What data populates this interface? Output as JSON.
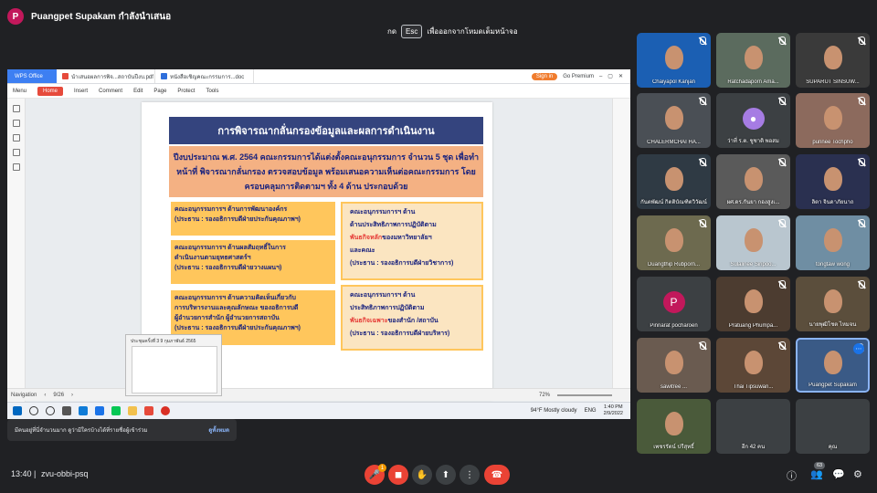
{
  "presenter": {
    "avatar_letter": "P",
    "text": "Puangpet Supakam กำลังนำเสนอ"
  },
  "esc_bar": {
    "prefix": "กด",
    "key": "Esc",
    "suffix": "เพื่อออกจากโหมดเต็มหน้าจอ"
  },
  "wps": {
    "app_tab": "WPS Office",
    "tabs": [
      "นำเสนอผลการพิจ...สถาบันปีงบ.pdf",
      "หนังสือเชิญคณะกรรมการ...doc"
    ],
    "sign_in": "Sign in",
    "go_premium": "Go Premium",
    "menu": [
      "Menu",
      "Home",
      "Insert",
      "Comment",
      "Edit",
      "Page",
      "Protect",
      "Tools"
    ],
    "navigation": "Navigation",
    "page_counter": "9/26",
    "zoom": "72%"
  },
  "slide": {
    "title": "การพิจารณากลั่นกรองข้อมูลและผลการดำเนินงาน",
    "intro": "ปีงบประมาณ พ.ศ. 2564 คณะกรรมการได้แต่งตั้งคณะอนุกรรมการ จำนวน 5 ชุด เพื่อทำหน้าที่ พิจารณากลั่นกรอง ตรวจสอบข้อมูล พร้อมเสนอความเห็นต่อคณะกรรมการ โดยครอบคลุมการติดตามฯ ทั้ง 4 ด้าน ประกอบด้วย",
    "box1": {
      "line1": "คณะอนุกรรมการฯ ด้านการพัฒนาองค์กร",
      "line2": "(ประธาน : รองอธิการบดีฝ่ายประกันคุณภาพฯ)"
    },
    "box2": {
      "line1": "คณะอนุกรรมการฯ ด้านผลสัมฤทธิ์ในการ",
      "line2": "ดำเนินงานตามยุทธศาสตร์ฯ",
      "line3": "(ประธาน : รองอธิการบดีฝ่ายวางแผนฯ)"
    },
    "box3": {
      "line1": "คณะอนุกรรมการฯ ด้านความคิดเห็นเกี่ยวกับ",
      "line2": "การบริหารงานและคุณลักษณะ ของอธิการบดี",
      "line3": "ผู้อำนวยการสำนัก ผู้อำนวยการสถาบัน",
      "line4": "(ประธาน : รองอธิการบดีฝ่ายประกันคุณภาพฯ)"
    },
    "box4": {
      "line1": "คณะอนุกรรมการฯ ด้าน",
      "line2": "ด้านประสิทธิภาพการปฏิบัติตาม",
      "red": "พันธกิจหลัก",
      "line3": "ของมหาวิทยาลัยฯ",
      "line4": "และคณะ",
      "line5": "(ประธาน : รองอธิการบดีฝ่ายวิชาการ)"
    },
    "box5": {
      "line1": "คณะอนุกรรมการฯ ด้าน",
      "line2": "ประสิทธิภาพการปฏิบัติตาม",
      "red": "พันธกิจเฉพาะ",
      "line3": "ของสำนัก /สถาบัน",
      "line4": "(ประธาน : รองอธิการบดีฝ่ายบริหาร)"
    }
  },
  "taskbar": {
    "weather": "94°F   Mostly cloudy",
    "lang": "ENG",
    "time": "1:40 PM",
    "date": "2/9/2022"
  },
  "thumbnail": {
    "title": "ประชุมครั้งที่ 3 9 กุมภาพันธ์ 2565"
  },
  "toast": {
    "text": "มีคนอยู่ที่นี่จำนวนมาก ดูว่ามีใครบ้างได้ที่รายชื่อผู้เข้าร่วม",
    "action": "ดูทั้งหมด"
  },
  "participants": [
    {
      "name": "Chaiyapol Kanjan"
    },
    {
      "name": "Ratchadaporn Ama..."
    },
    {
      "name": "SUPARUT SINSUW..."
    },
    {
      "name": "CHALERMCHAI HA..."
    },
    {
      "name": "ว่าที่ ร.ต. ชูชาติ พอสม",
      "avatar": "person-icon"
    },
    {
      "name": "punnee Tochpho"
    },
    {
      "name": "กันตพัฒน์ กิตติบัณฑิตวิวัฒน์"
    },
    {
      "name": "ผศ.ดร.กันยา กองสูงเ..."
    },
    {
      "name": "ลิตา จินดาภัยนาถ"
    },
    {
      "name": "Duangthip Rubporn..."
    },
    {
      "name": "Sulalinee Siripoo..."
    },
    {
      "name": "tongtaw wong"
    },
    {
      "name": "Pinnarat pocharoen",
      "avatar": "P"
    },
    {
      "name": "Pratuang Phumpa..."
    },
    {
      "name": "นายพุฒิโชต ไหมจน"
    },
    {
      "name": "sawitree ..."
    },
    {
      "name": "Thai Tipsuwan..."
    },
    {
      "name": "Puangpet Supakam"
    },
    {
      "name": "เพชรรัตน์ ปรีสุทธิ์"
    },
    {
      "name": "อีก 42 คน"
    },
    {
      "name": "คุณ"
    }
  ],
  "bottom": {
    "time": "13:40",
    "separator": "|",
    "meeting_id": "zvu-obbi-psq",
    "participant_count": "63",
    "hand_count": "1"
  },
  "colors": {
    "title_bar": "#34447e",
    "intro_bg": "#f4b183",
    "box_bg": "#ffc65c",
    "end_call": "#ea4335"
  }
}
